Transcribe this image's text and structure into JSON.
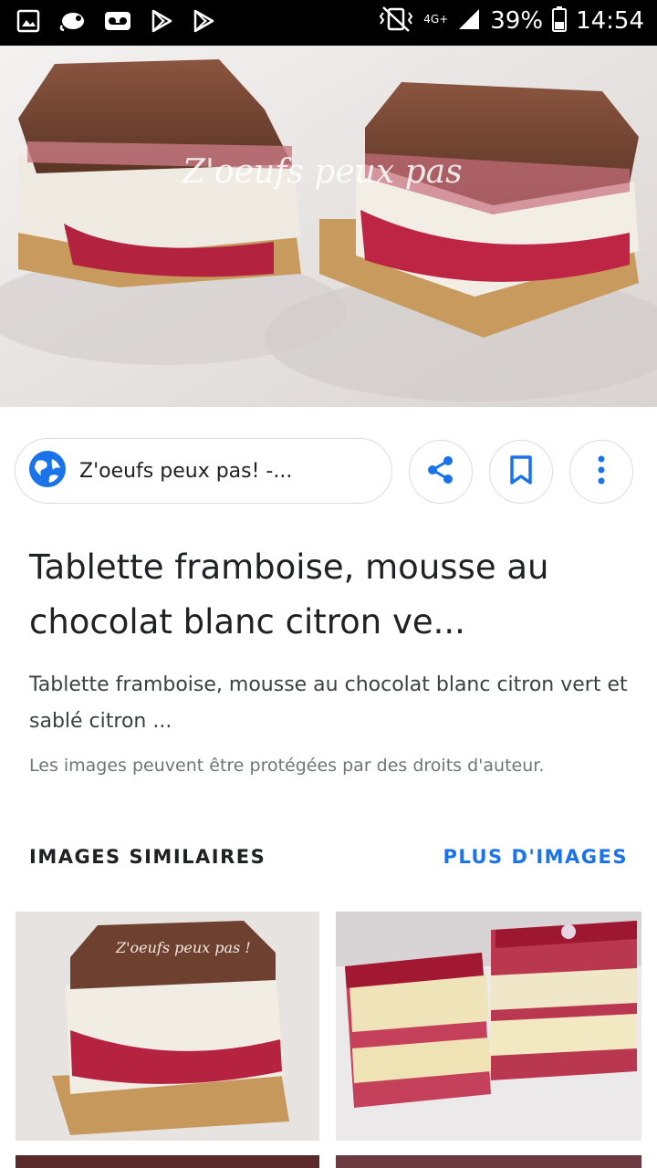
{
  "status_bar": {
    "network": "4G+",
    "battery": "39%",
    "time": "14:54",
    "left_icons": [
      "gallery-icon",
      "chameleon-icon",
      "voicemail-icon",
      "play-store-icon",
      "play-store-icon"
    ],
    "right_icons": [
      "vibrate-icon",
      "signal-icon",
      "battery-icon"
    ]
  },
  "hero": {
    "watermark": "Z'oeufs peux pas",
    "alt": "Tablette framboise"
  },
  "source": {
    "label": "Z'oeufs peux pas! -...",
    "icon": "globe-icon"
  },
  "actions": {
    "share_icon": "share-icon",
    "bookmark_icon": "bookmark-icon",
    "more_icon": "more-vert-icon"
  },
  "result": {
    "title": "Tablette framboise, mousse au chocolat blanc citron ve...",
    "description": "Tablette framboise, mousse au chocolat blanc citron vert et sablé citron ...",
    "copyright": "Les images peuvent être protégées par des droits d'auteur."
  },
  "similar": {
    "label": "IMAGES SIMILAIRES",
    "more": "PLUS D'IMAGES",
    "thumb1_watermark": "Z'oeufs peux pas !"
  },
  "colors": {
    "accent": "#1a73e8",
    "statusbar": "#000000"
  }
}
